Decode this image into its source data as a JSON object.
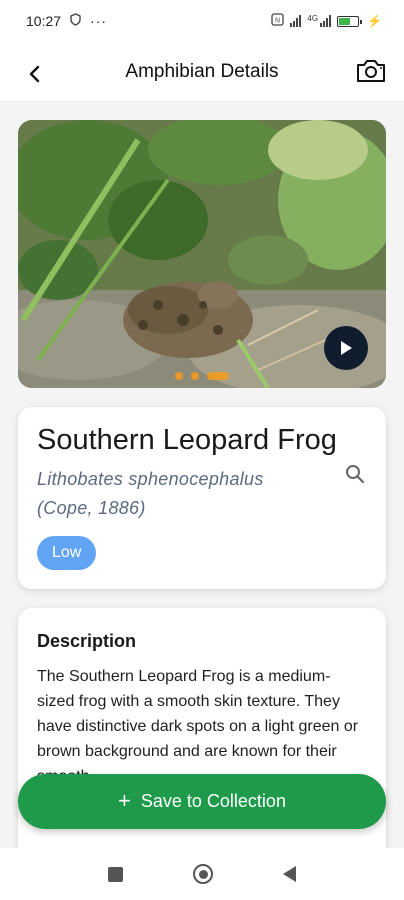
{
  "status_bar": {
    "time": "10:27",
    "notification_icons": [
      "shield-icon",
      "more-dots-icon"
    ],
    "right_icons": [
      "nfc-icon",
      "signal-icon",
      "wifi-icon",
      "battery-icon",
      "charging-icon"
    ],
    "network_label": "4G"
  },
  "app_bar": {
    "title": "Amphibian Details",
    "back_icon": "arrow-back-icon",
    "camera_icon": "camera-icon"
  },
  "media": {
    "image_description": "frog-in-grass-photo",
    "carousel_count": 3,
    "active_index": 2,
    "play_icon": "play-icon"
  },
  "species": {
    "common_name": "Southern Leopard Frog",
    "scientific_name": "Lithobates sphenocephalus",
    "authority": "(Cope, 1886)",
    "badge": "Low",
    "search_icon": "search-icon"
  },
  "description": {
    "title": "Description",
    "text": "The Southern Leopard Frog is a medium-sized frog with a smooth skin texture. They have distinctive dark spots on a light green or brown background and are known for their smooth"
  },
  "actions": {
    "save_label": "Save to Collection",
    "save_icon": "plus-icon"
  },
  "colors": {
    "accent_green": "#1e9a4a",
    "badge_blue": "#62a4f4",
    "dot_orange": "#f29b1f",
    "play_bg": "#0f1d2e",
    "scientific_text": "#5a6a80"
  }
}
